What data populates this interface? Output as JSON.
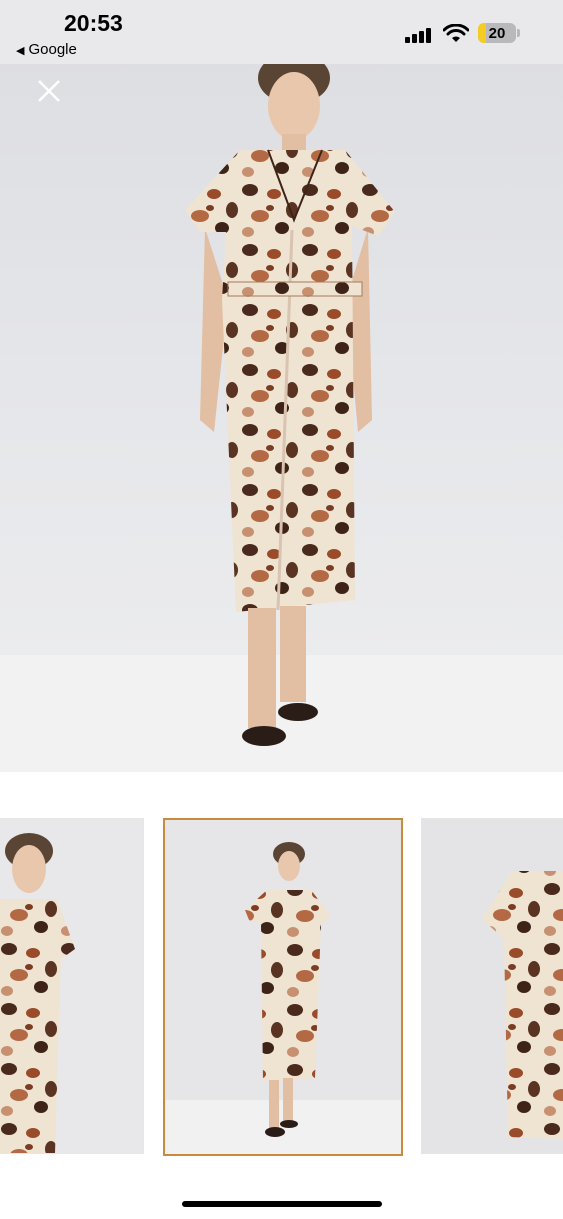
{
  "status_bar": {
    "time": "20:53",
    "back_label": "Google",
    "back_icon": "triangle-left-icon",
    "battery_level": "20",
    "battery_fraction": 0.2
  },
  "hero": {
    "close_icon": "close-icon",
    "image_alt": "model wearing leopard print midi shirt dress"
  },
  "thumbnails": [
    {
      "name": "thumbnail-closeup",
      "selected": false
    },
    {
      "name": "thumbnail-full-length",
      "selected": true
    },
    {
      "name": "thumbnail-product-flat",
      "selected": false
    }
  ],
  "colors": {
    "accent": "#c98a3e",
    "status_bg": "#e9e9ec",
    "battery_yellow": "#f4cc22"
  }
}
